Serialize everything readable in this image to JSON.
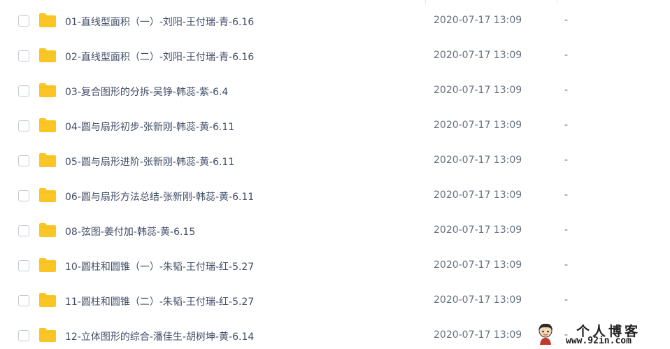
{
  "file_list": {
    "rows": [
      {
        "name": "01-直线型面积（一）-刘阳-王付瑞-青-6.16",
        "modified": "2020-07-17 13:09",
        "size": "-"
      },
      {
        "name": "02-直线型面积（二）-刘阳-王付瑞-青-6.16",
        "modified": "2020-07-17 13:09",
        "size": "-"
      },
      {
        "name": "03-复合图形的分拆-吴铮-韩蕊-紫-6.4",
        "modified": "2020-07-17 13:09",
        "size": "-"
      },
      {
        "name": "04-圆与扇形初步-张新刚-韩蕊-黄-6.11",
        "modified": "2020-07-17 13:09",
        "size": "-"
      },
      {
        "name": "05-圆与扇形进阶-张新刚-韩蕊-黄-6.11",
        "modified": "2020-07-17 13:09",
        "size": "-"
      },
      {
        "name": "06-圆与扇形方法总结-张新刚-韩蕊-黄-6.11",
        "modified": "2020-07-17 13:09",
        "size": "-"
      },
      {
        "name": "08-弦图-姜付加-韩蕊-黄-6.15",
        "modified": "2020-07-17 13:09",
        "size": "-"
      },
      {
        "name": "10-圆柱和圆锥（一）-朱韬-王付瑞-红-5.27",
        "modified": "2020-07-17 13:09",
        "size": "-"
      },
      {
        "name": "11-圆柱和圆锥（二）-朱韬-王付瑞-红-5.27",
        "modified": "2020-07-17 13:09",
        "size": "-"
      },
      {
        "name": "12-立体图形的综合-潘佳生-胡树坤-黄-6.14",
        "modified": "2020-07-17 13:09",
        "size": "-"
      }
    ],
    "folder_icon": "folder-icon",
    "folder_color": "#f9c626"
  },
  "watermark": {
    "title": "个人博客",
    "url": "www.92in.com"
  }
}
